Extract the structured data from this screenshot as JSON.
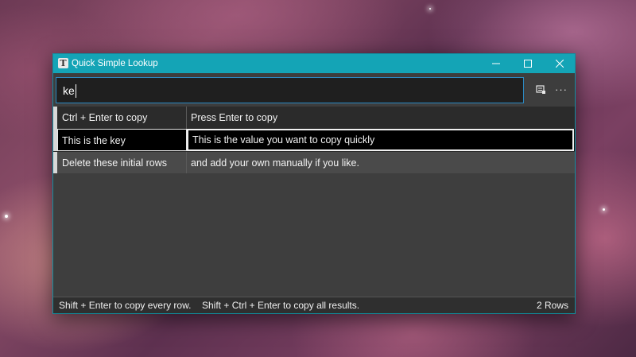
{
  "window": {
    "title": "Quick Simple Lookup",
    "app_icon_letter": "T"
  },
  "search": {
    "value": "ke",
    "placeholder": ""
  },
  "toolbar": {
    "import_icon": "import-icon",
    "more_icon": "more-icon",
    "more_label": "···"
  },
  "grid": {
    "header": {
      "key": "Ctrl + Enter to copy",
      "value": "Press Enter to copy"
    },
    "rows": [
      {
        "key": "This is the key",
        "value": "This is the value you want to copy quickly",
        "selected": true
      },
      {
        "key": "Delete these initial rows",
        "value": "and add your own manually if you like.",
        "selected": false
      }
    ]
  },
  "status": {
    "hint_every_row": "Shift + Enter to copy every row.",
    "hint_all_results": "Shift + Ctrl + Enter to copy all results.",
    "row_count": "2 Rows"
  },
  "colors": {
    "titlebar": "#14a4b6",
    "search_border": "#2c89c2",
    "window_bg": "#3d3d3d"
  }
}
